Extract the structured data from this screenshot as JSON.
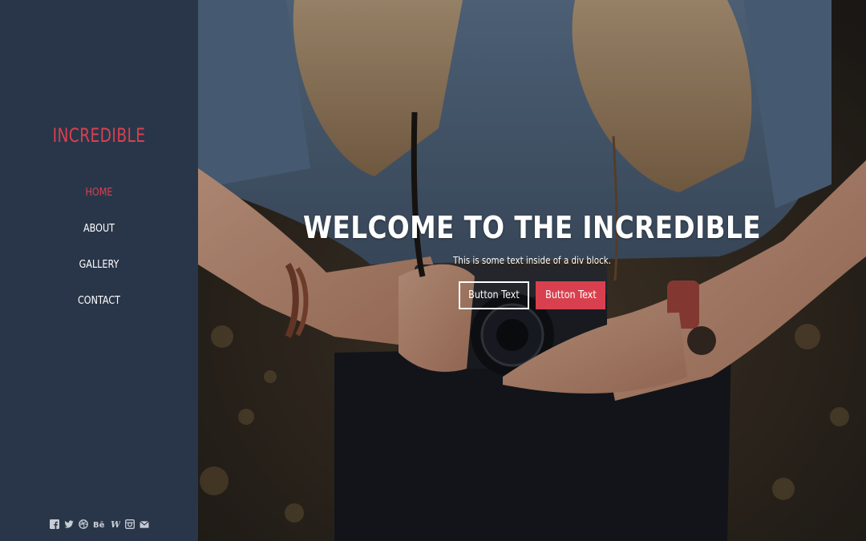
{
  "colors": {
    "sidebar_bg": "#293649",
    "accent": "#d9404f",
    "text": "#ffffff"
  },
  "sidebar": {
    "brand": "INCREDIBLE",
    "nav": [
      {
        "label": "HOME",
        "active": true
      },
      {
        "label": "ABOUT",
        "active": false
      },
      {
        "label": "GALLERY",
        "active": false
      },
      {
        "label": "CONTACT",
        "active": false
      }
    ],
    "social": [
      "facebook-icon",
      "twitter-icon",
      "dribbble-icon",
      "behance-icon",
      "wordpress-icon",
      "instagram-icon",
      "mail-icon"
    ]
  },
  "hero": {
    "title": "WELCOME TO THE INCREDIBLE",
    "subtitle": "This is some text inside of a div block.",
    "button_primary": "Button Text",
    "button_secondary": "Button Text"
  }
}
